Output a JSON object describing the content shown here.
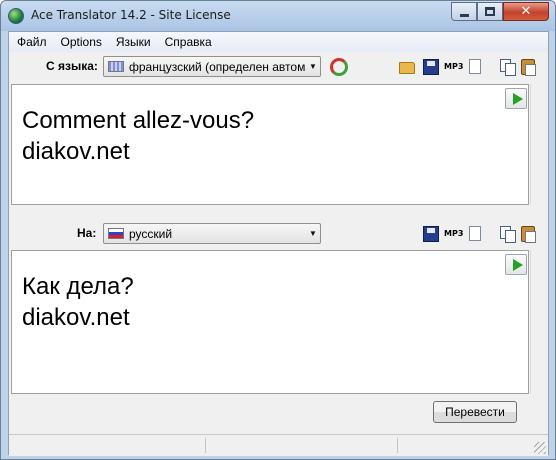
{
  "window": {
    "title": "Ace Translator 14.2 - Site License",
    "controls": {
      "minimize": "",
      "maximize": "",
      "close": "✕"
    }
  },
  "menu": {
    "items": [
      "Файл",
      "Options",
      "Языки",
      "Справка"
    ]
  },
  "source": {
    "label": "С языка:",
    "language": "французский (определен автом",
    "text": "Comment allez-vous?\ndiakov.net"
  },
  "target": {
    "label": "На:",
    "language": "русский",
    "text": "Как дела?\ndiakov.net"
  },
  "icons": {
    "mp3": "MP3"
  },
  "actions": {
    "translate": "Перевести"
  }
}
